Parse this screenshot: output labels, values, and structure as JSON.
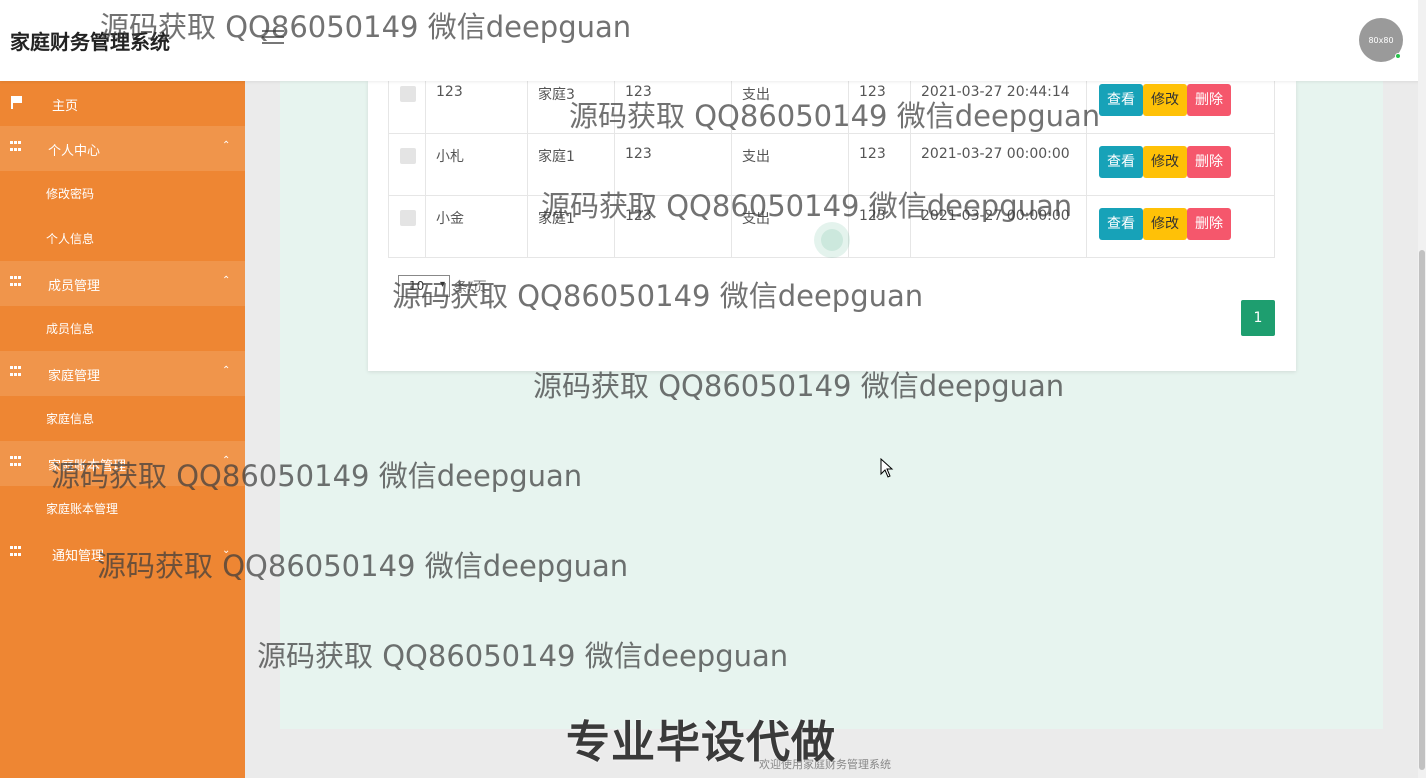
{
  "header": {
    "brand": "家庭财务管理系统",
    "avatar_text": "80x80"
  },
  "sidebar": {
    "home": "主页",
    "groups": [
      {
        "label": "个人中心",
        "caret": "⌃",
        "items": [
          "修改密码",
          "个人信息"
        ]
      },
      {
        "label": "成员管理",
        "caret": "⌃",
        "items": [
          "成员信息"
        ]
      },
      {
        "label": "家庭管理",
        "caret": "⌃",
        "items": [
          "家庭信息"
        ]
      },
      {
        "label": "家庭账本管理",
        "caret": "⌃",
        "items": [
          "家庭账本管理"
        ]
      },
      {
        "label": "通知管理",
        "caret": "⌄",
        "items": []
      }
    ]
  },
  "table": {
    "rows": [
      {
        "name": "123",
        "family": "家庭3",
        "c3": "123",
        "type": "支出",
        "amount": "123",
        "time": "2021-03-27 20:44:14"
      },
      {
        "name": "小札",
        "family": "家庭1",
        "c3": "123",
        "type": "支出",
        "amount": "123",
        "time": "2021-03-27 00:00:00"
      },
      {
        "name": "小金",
        "family": "家庭1",
        "c3": "123",
        "type": "支出",
        "amount": "123",
        "time": "2021-03-27 00:00:00"
      }
    ],
    "actions": {
      "view": "查看",
      "edit": "修改",
      "delete": "删除"
    }
  },
  "pagination": {
    "page_size": "10",
    "per_page_label": "条/页",
    "current_page": "1"
  },
  "watermarks": {
    "text": "源码获取 QQ86050149 微信deepguan",
    "big": "专业毕设代做"
  },
  "footer": "欢迎使用家庭财务管理系统"
}
